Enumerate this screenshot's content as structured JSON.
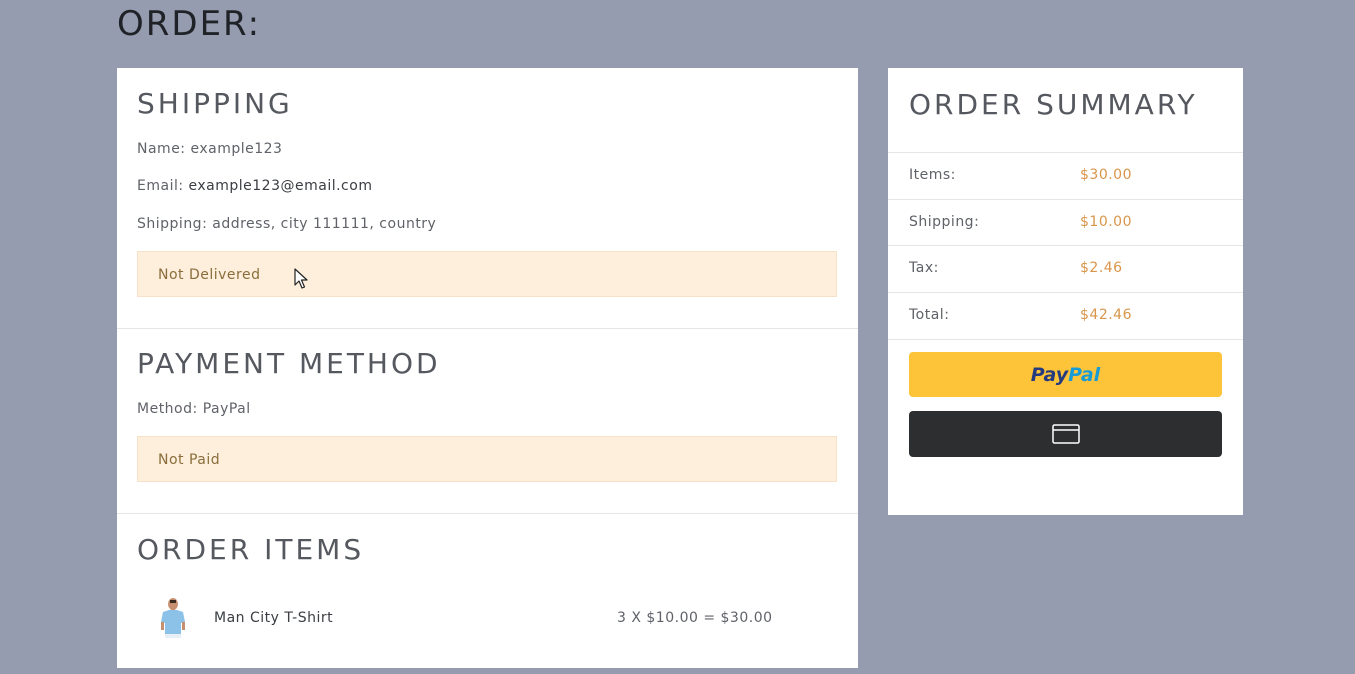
{
  "page": {
    "title": "ORDER:"
  },
  "shipping": {
    "heading": "SHIPPING",
    "name_label": "Name: ",
    "name_value": "example123",
    "email_label": "Email: ",
    "email_value": "example123@email.com",
    "address_label": "Shipping: ",
    "address_value": "address, city 111111, country",
    "status": "Not Delivered"
  },
  "payment": {
    "heading": "PAYMENT METHOD",
    "method_label": "Method: ",
    "method_value": "PayPal",
    "status": "Not Paid"
  },
  "order_items": {
    "heading": "ORDER ITEMS",
    "items": [
      {
        "name": "Man City T-Shirt",
        "total": "3 X $10.00 = $30.00",
        "thumbnail": "tshirt-product-image"
      }
    ]
  },
  "summary": {
    "heading": "ORDER SUMMARY",
    "rows": [
      {
        "label": "Items:",
        "amount": "$30.00"
      },
      {
        "label": "Shipping:",
        "amount": "$10.00"
      },
      {
        "label": "Tax:",
        "amount": "$2.46"
      },
      {
        "label": "Total:",
        "amount": "$42.46"
      }
    ],
    "paypal_button": {
      "pay": "Pay",
      "pal": "Pal"
    },
    "card_button_icon": "credit-card-icon"
  },
  "colors": {
    "background": "#969cb0",
    "alert_background": "#fdefdc",
    "alert_text": "#8a6d3b",
    "amount_text": "#d9954a",
    "paypal_yellow": "#fec439",
    "card_button_dark": "#2c2e2f"
  }
}
